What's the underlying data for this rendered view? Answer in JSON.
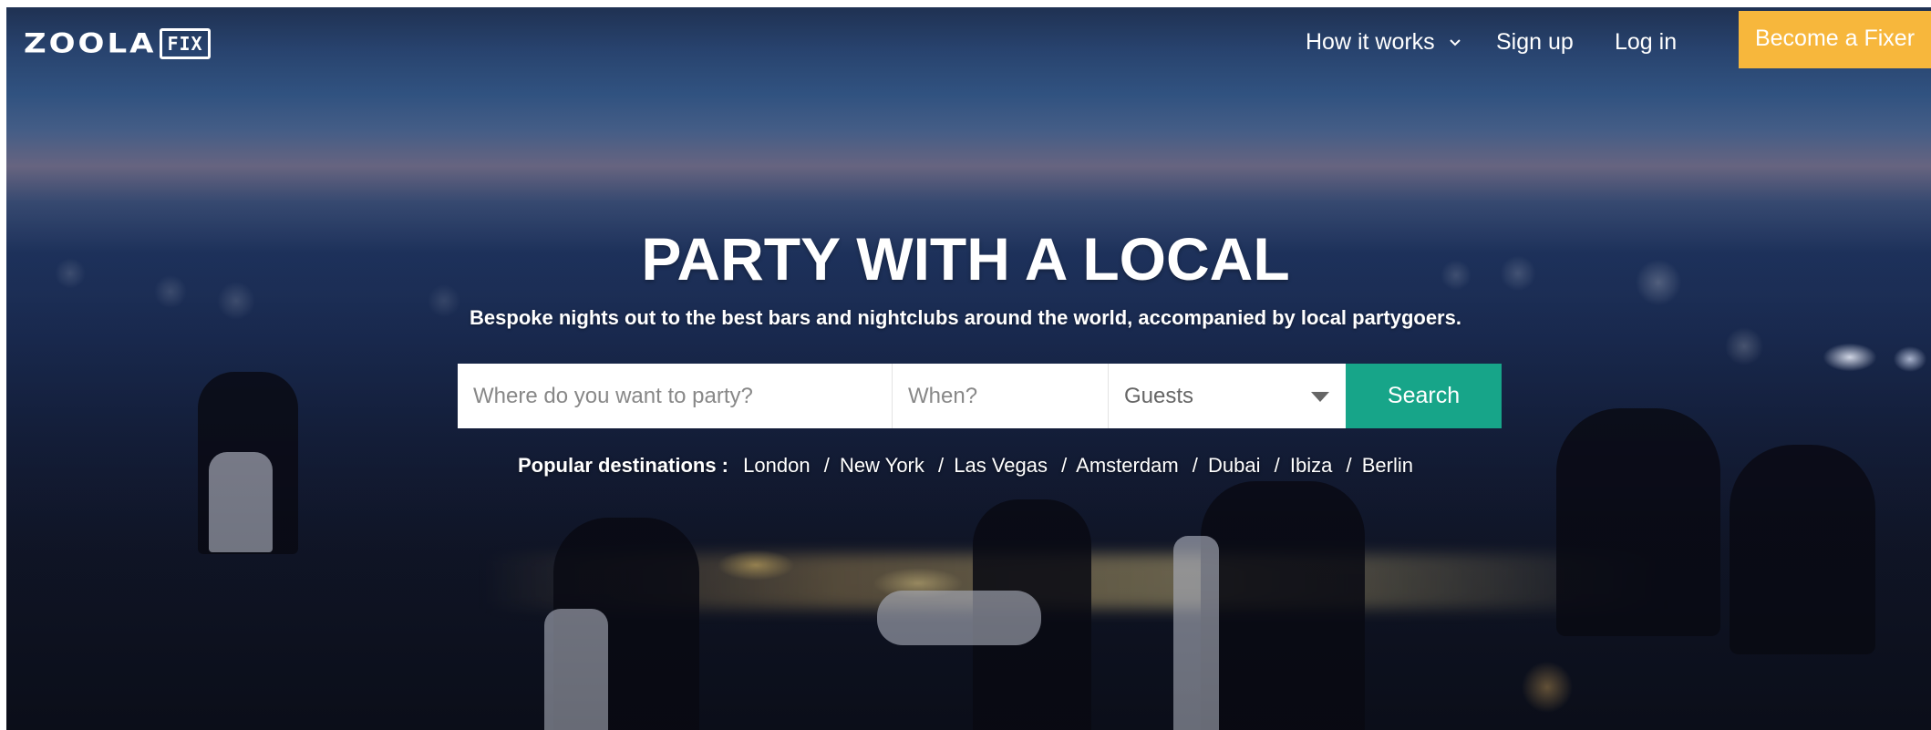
{
  "brand": {
    "logo_main": "ZOOLA",
    "logo_badge": "FIX"
  },
  "nav": {
    "how_it_works": "How it works",
    "sign_up": "Sign up",
    "log_in": "Log in",
    "cta": "Become a Fixer"
  },
  "hero": {
    "title": "PARTY WITH A LOCAL",
    "subtitle": "Bespoke nights out to the best bars and nightclubs around the world, accompanied by local partygoers."
  },
  "search": {
    "where_placeholder": "Where do you want to party?",
    "when_placeholder": "When?",
    "guests_selected": "Guests",
    "button": "Search"
  },
  "popular": {
    "label": "Popular destinations :",
    "separator": "/",
    "destinations": [
      "London",
      "New York",
      "Las Vegas",
      "Amsterdam",
      "Dubai",
      "Ibiza",
      "Berlin"
    ]
  },
  "colors": {
    "cta": "#f7b73c",
    "search_button": "#17a589",
    "text": "#ffffff"
  }
}
